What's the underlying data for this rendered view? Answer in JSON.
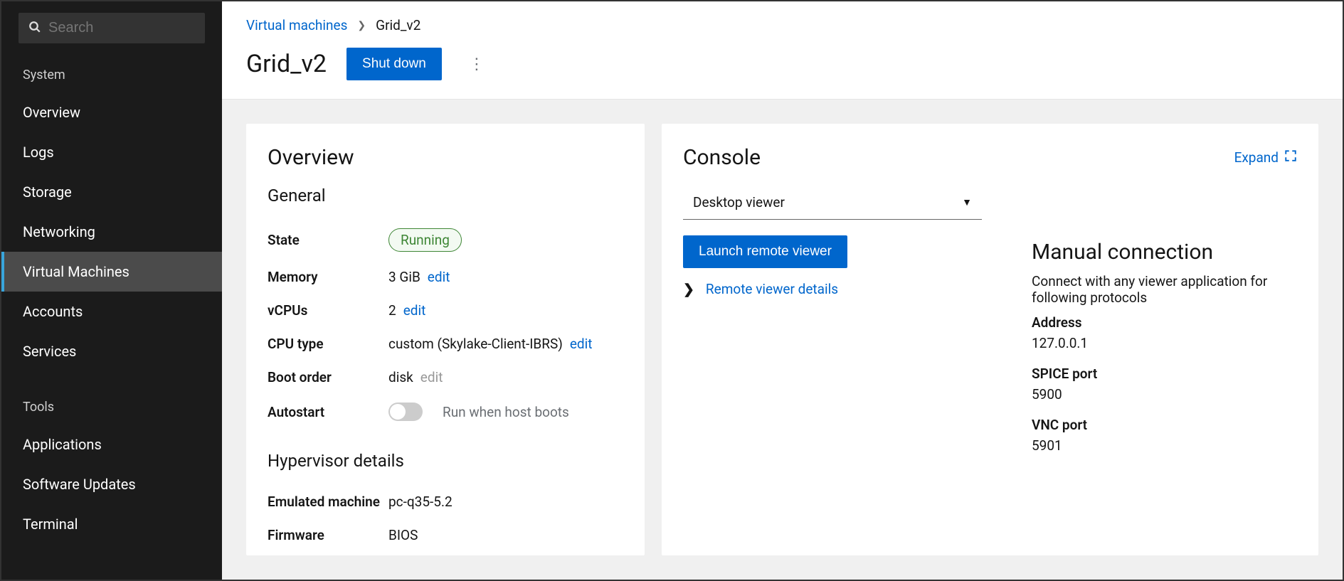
{
  "sidebar": {
    "search_placeholder": "Search",
    "section_system": "System",
    "items_system": [
      "Overview",
      "Logs",
      "Storage",
      "Networking",
      "Virtual Machines",
      "Accounts",
      "Services"
    ],
    "active_index": 4,
    "section_tools": "Tools",
    "items_tools": [
      "Applications",
      "Software Updates",
      "Terminal"
    ]
  },
  "breadcrumb": {
    "parent": "Virtual machines",
    "current": "Grid_v2"
  },
  "header": {
    "title": "Grid_v2",
    "shutdown_label": "Shut down"
  },
  "overview": {
    "title": "Overview",
    "general_title": "General",
    "labels": {
      "state": "State",
      "memory": "Memory",
      "vcpus": "vCPUs",
      "cpu_type": "CPU type",
      "boot_order": "Boot order",
      "autostart": "Autostart"
    },
    "values": {
      "state": "Running",
      "memory": "3 GiB",
      "vcpus": "2",
      "cpu_type": "custom (Skylake-Client-IBRS)",
      "boot_order": "disk",
      "autostart_desc": "Run when host boots"
    },
    "edit_label": "edit",
    "hypervisor": {
      "title": "Hypervisor details",
      "labels": {
        "emulated": "Emulated machine",
        "firmware": "Firmware"
      },
      "values": {
        "emulated": "pc-q35-5.2",
        "firmware": "BIOS"
      }
    }
  },
  "console": {
    "title": "Console",
    "expand_label": "Expand",
    "viewer_selected": "Desktop viewer",
    "launch_label": "Launch remote viewer",
    "details_label": "Remote viewer details",
    "manual": {
      "title": "Manual connection",
      "desc": "Connect with any viewer application for following protocols",
      "address_label": "Address",
      "address_value": "127.0.0.1",
      "spice_label": "SPICE port",
      "spice_value": "5900",
      "vnc_label": "VNC port",
      "vnc_value": "5901"
    }
  }
}
